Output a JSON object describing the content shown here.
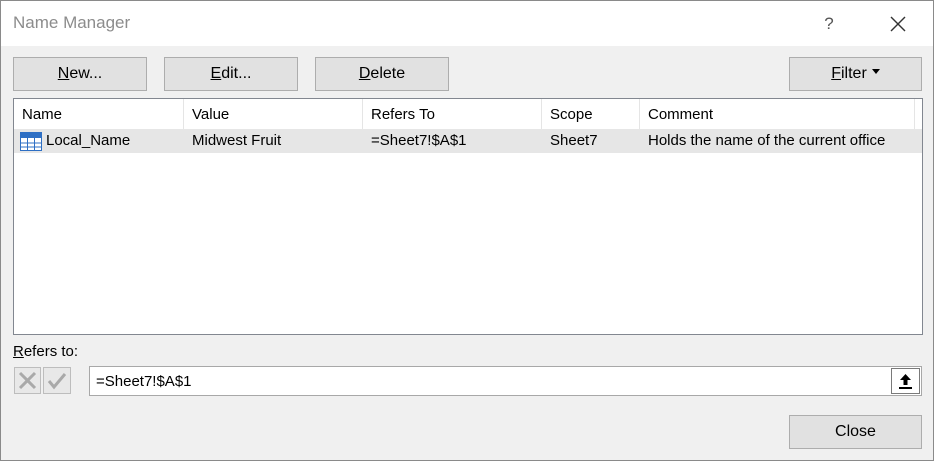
{
  "dialog": {
    "title": "Name Manager",
    "help_label": "?"
  },
  "toolbar": {
    "new_pre": "",
    "new_key": "N",
    "new_post": "ew...",
    "edit_pre": "",
    "edit_key": "E",
    "edit_post": "dit...",
    "delete_pre": "",
    "delete_key": "D",
    "delete_post": "elete",
    "filter_pre": "",
    "filter_key": "F",
    "filter_post": "ilter"
  },
  "table": {
    "columns": [
      "Name",
      "Value",
      "Refers To",
      "Scope",
      "Comment"
    ],
    "rows": [
      {
        "name": "Local_Name",
        "value": "Midwest Fruit",
        "refers_to": "=Sheet7!$A$1",
        "scope": "Sheet7",
        "comment": "Holds the name of the current office",
        "icon": "table-grid-icon",
        "selected": true
      }
    ]
  },
  "refers": {
    "label_key": "R",
    "label_post": "efers to:",
    "value": "=Sheet7!$A$1"
  },
  "footer": {
    "close_label": "Close"
  },
  "colors": {
    "title_text": "#8c8c8c",
    "button_face": "#e1e1e1",
    "selected_row": "#e6e6e6",
    "dialog_bg": "#f0f0f0",
    "icon_blue": "#2e6fc4"
  }
}
